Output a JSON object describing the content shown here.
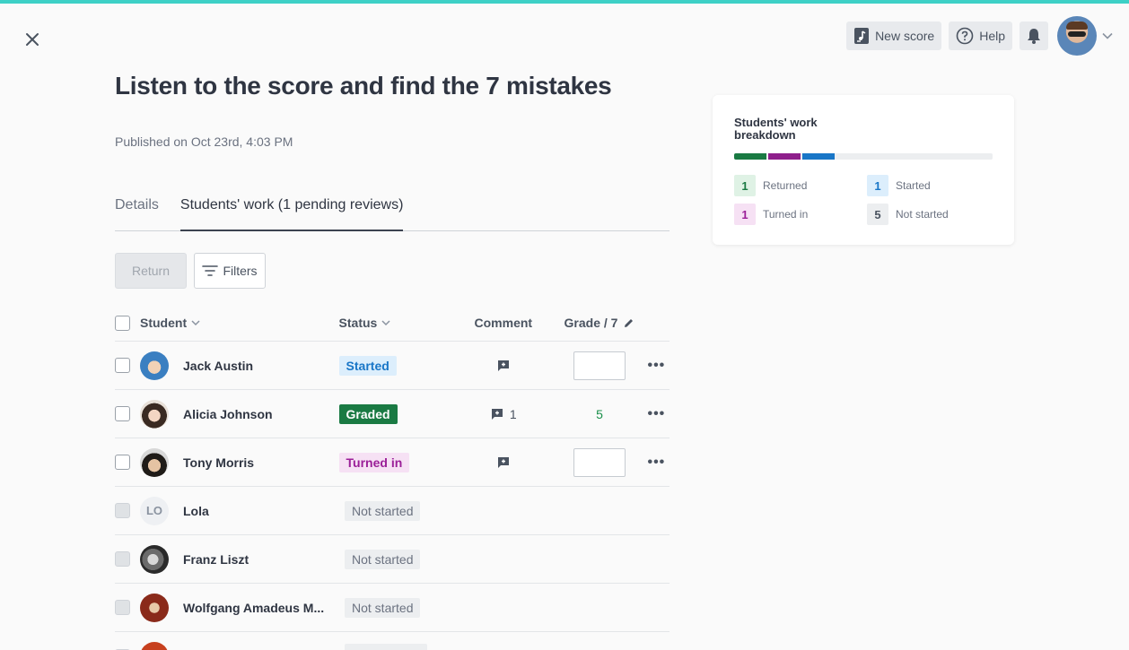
{
  "header": {
    "new_score_label": "New score",
    "help_label": "Help"
  },
  "assignment": {
    "title": "Listen to the score and find the 7 mistakes",
    "published": "Published on Oct 23rd, 4:03 PM"
  },
  "tabs": [
    {
      "label": "Details",
      "active": false
    },
    {
      "label": "Students' work (1 pending reviews)",
      "active": true
    }
  ],
  "actions": {
    "return_label": "Return",
    "filters_label": "Filters"
  },
  "table": {
    "headers": {
      "student": "Student",
      "status": "Status",
      "comment": "Comment",
      "grade": "Grade / 7"
    },
    "rows": [
      {
        "name": "Jack Austin",
        "status": "Started",
        "comment_count": "",
        "grade": ""
      },
      {
        "name": "Alicia Johnson",
        "status": "Graded",
        "comment_count": "1",
        "grade": "5"
      },
      {
        "name": "Tony Morris",
        "status": "Turned in",
        "comment_count": "",
        "grade": ""
      },
      {
        "name": "Lola",
        "initials": "LO",
        "status": "Not started"
      },
      {
        "name": "Franz Liszt",
        "status": "Not started"
      },
      {
        "name": "Wolfgang Amadeus M...",
        "status": "Not started"
      }
    ]
  },
  "breakdown": {
    "title": "Students' work breakdown",
    "colors": {
      "returned": "#1a7a43",
      "turned_in": "#8e1f8b",
      "started": "#1976c7",
      "remaining": "#eceef0"
    },
    "legend": {
      "returned": {
        "count": "1",
        "label": "Returned"
      },
      "started": {
        "count": "1",
        "label": "Started"
      },
      "turned_in": {
        "count": "1",
        "label": "Turned in"
      },
      "not_started": {
        "count": "5",
        "label": "Not started"
      }
    }
  }
}
